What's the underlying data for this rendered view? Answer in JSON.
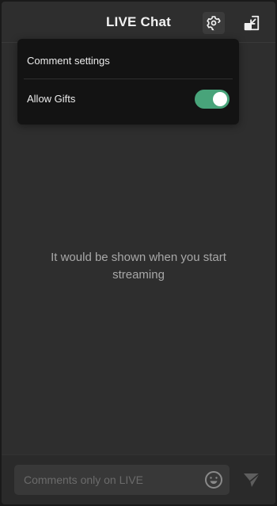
{
  "header": {
    "title": "LIVE Chat",
    "settings_icon": "settings-gear-icon",
    "popout_icon": "popout-window-icon"
  },
  "settings_menu": {
    "comment_settings_label": "Comment settings",
    "allow_gifts_label": "Allow Gifts",
    "allow_gifts_enabled": true,
    "toggle_color": "#48a47a"
  },
  "chat": {
    "empty_message": "It would be shown when you start streaming"
  },
  "composer": {
    "placeholder": "Comments only on LIVE",
    "emoji_icon": "emoji-icon",
    "send_icon": "send-icon"
  }
}
